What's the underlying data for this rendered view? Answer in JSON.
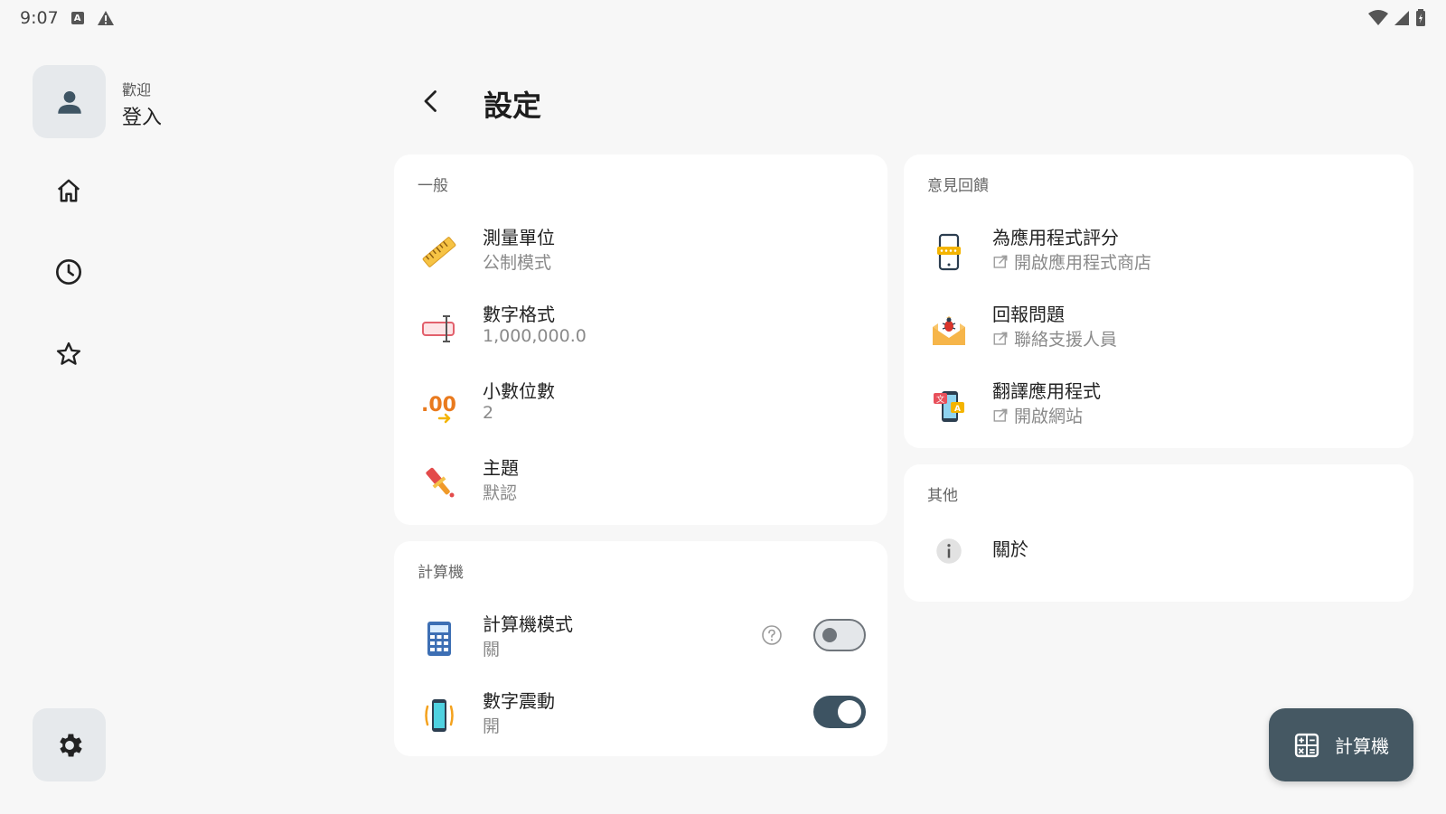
{
  "status_bar": {
    "time": "9:07"
  },
  "profile": {
    "welcome": "歡迎",
    "login": "登入"
  },
  "header": {
    "title": "設定"
  },
  "general": {
    "title": "一般",
    "items": [
      {
        "title": "測量單位",
        "subtitle": "公制模式",
        "icon": "ruler-icon"
      },
      {
        "title": "數字格式",
        "subtitle": "1,000,000.0",
        "icon": "number-format-icon"
      },
      {
        "title": "小數位數",
        "subtitle": "2",
        "icon": "decimal-places-icon"
      },
      {
        "title": "主題",
        "subtitle": "默認",
        "icon": "paint-brush-icon"
      }
    ]
  },
  "calculator": {
    "title": "計算機",
    "items": [
      {
        "title": "計算機模式",
        "subtitle": "關",
        "icon": "calculator-icon",
        "toggle": false
      },
      {
        "title": "數字震動",
        "subtitle": "開",
        "icon": "vibration-icon",
        "toggle": true
      }
    ]
  },
  "feedback": {
    "title": "意見回饋",
    "items": [
      {
        "title": "為應用程式評分",
        "subtitle": "開啟應用程式商店",
        "icon": "rate-phone-icon"
      },
      {
        "title": "回報問題",
        "subtitle": "聯絡支援人員",
        "icon": "bug-mail-icon"
      },
      {
        "title": "翻譯應用程式",
        "subtitle": "開啟網站",
        "icon": "translate-icon"
      }
    ]
  },
  "other": {
    "title": "其他",
    "items": [
      {
        "title": "關於",
        "icon": "info-icon"
      }
    ]
  },
  "fab": {
    "label": "計算機"
  },
  "colors": {
    "background": "#f7f7f7",
    "card": "#ffffff",
    "accent": "#3d5362",
    "fab": "#455863"
  }
}
